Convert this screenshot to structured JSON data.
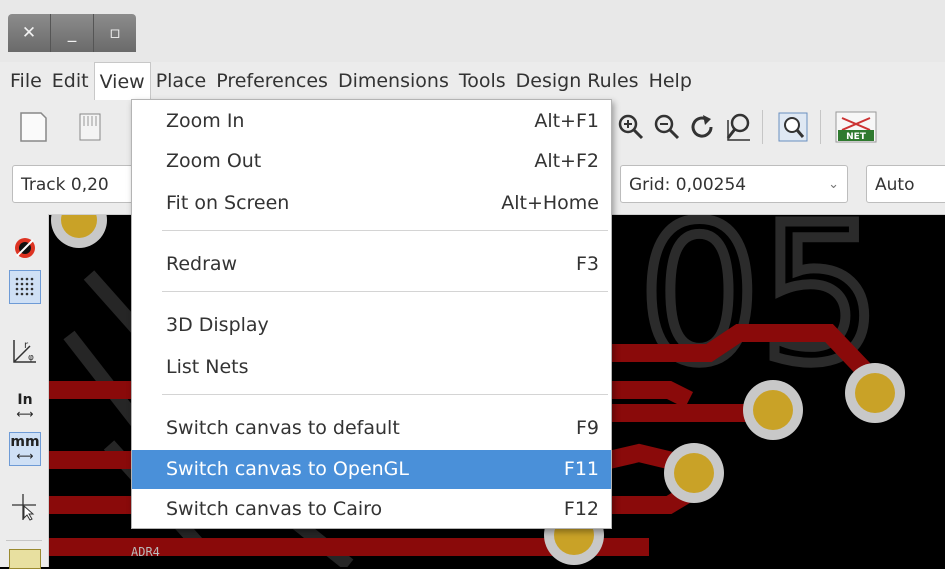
{
  "window": {
    "controls": [
      {
        "name": "close-icon",
        "glyph": "✕"
      },
      {
        "name": "minimize-icon",
        "glyph": "_"
      },
      {
        "name": "maximize-icon",
        "glyph": "▫"
      }
    ]
  },
  "menubar": {
    "items": [
      "File",
      "Edit",
      "View",
      "Place",
      "Preferences",
      "Dimensions",
      "Tools",
      "Design Rules",
      "Help"
    ],
    "open_index": 2
  },
  "toolbar2": {
    "track_value": "Track 0,20",
    "grid_value": "Grid: 0,00254",
    "zoom_value": "Auto"
  },
  "left_toolbar": {
    "inch_label": "In",
    "mm_label": "mm"
  },
  "canvas": {
    "silk_label": "ADR4",
    "big_text": "05"
  },
  "view_menu": {
    "items": [
      {
        "label": "Zoom In",
        "shortcut": "Alt+F1"
      },
      {
        "label": "Zoom Out",
        "shortcut": "Alt+F2"
      },
      {
        "label": "Fit on Screen",
        "shortcut": "Alt+Home"
      },
      {
        "label": "Redraw",
        "shortcut": "F3"
      },
      {
        "label": "3D Display",
        "shortcut": ""
      },
      {
        "label": "List Nets",
        "shortcut": ""
      },
      {
        "label": "Switch canvas to default",
        "shortcut": "F9"
      },
      {
        "label": "Switch canvas to OpenGL",
        "shortcut": "F11"
      },
      {
        "label": "Switch canvas to Cairo",
        "shortcut": "F12"
      }
    ],
    "highlighted_index": 7
  },
  "colors": {
    "highlight": "#4a90d9",
    "trace": "#8a0a0a",
    "pad_ring": "#c8c8c8",
    "pad_core": "#c9a227"
  }
}
